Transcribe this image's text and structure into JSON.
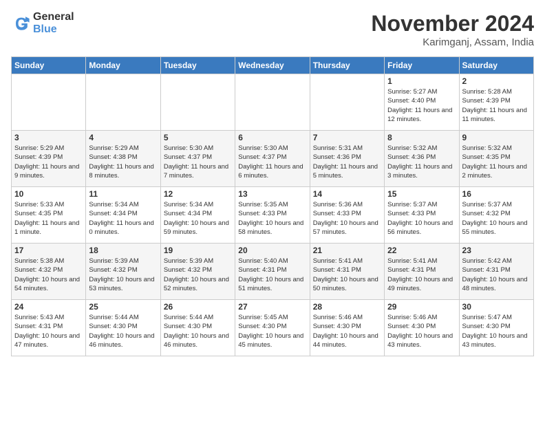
{
  "header": {
    "logo_general": "General",
    "logo_blue": "Blue",
    "month_title": "November 2024",
    "location": "Karimganj, Assam, India"
  },
  "calendar": {
    "days_of_week": [
      "Sunday",
      "Monday",
      "Tuesday",
      "Wednesday",
      "Thursday",
      "Friday",
      "Saturday"
    ],
    "weeks": [
      [
        {
          "day": "",
          "info": ""
        },
        {
          "day": "",
          "info": ""
        },
        {
          "day": "",
          "info": ""
        },
        {
          "day": "",
          "info": ""
        },
        {
          "day": "",
          "info": ""
        },
        {
          "day": "1",
          "info": "Sunrise: 5:27 AM\nSunset: 4:40 PM\nDaylight: 11 hours and 12 minutes."
        },
        {
          "day": "2",
          "info": "Sunrise: 5:28 AM\nSunset: 4:39 PM\nDaylight: 11 hours and 11 minutes."
        }
      ],
      [
        {
          "day": "3",
          "info": "Sunrise: 5:29 AM\nSunset: 4:39 PM\nDaylight: 11 hours and 9 minutes."
        },
        {
          "day": "4",
          "info": "Sunrise: 5:29 AM\nSunset: 4:38 PM\nDaylight: 11 hours and 8 minutes."
        },
        {
          "day": "5",
          "info": "Sunrise: 5:30 AM\nSunset: 4:37 PM\nDaylight: 11 hours and 7 minutes."
        },
        {
          "day": "6",
          "info": "Sunrise: 5:30 AM\nSunset: 4:37 PM\nDaylight: 11 hours and 6 minutes."
        },
        {
          "day": "7",
          "info": "Sunrise: 5:31 AM\nSunset: 4:36 PM\nDaylight: 11 hours and 5 minutes."
        },
        {
          "day": "8",
          "info": "Sunrise: 5:32 AM\nSunset: 4:36 PM\nDaylight: 11 hours and 3 minutes."
        },
        {
          "day": "9",
          "info": "Sunrise: 5:32 AM\nSunset: 4:35 PM\nDaylight: 11 hours and 2 minutes."
        }
      ],
      [
        {
          "day": "10",
          "info": "Sunrise: 5:33 AM\nSunset: 4:35 PM\nDaylight: 11 hours and 1 minute."
        },
        {
          "day": "11",
          "info": "Sunrise: 5:34 AM\nSunset: 4:34 PM\nDaylight: 11 hours and 0 minutes."
        },
        {
          "day": "12",
          "info": "Sunrise: 5:34 AM\nSunset: 4:34 PM\nDaylight: 10 hours and 59 minutes."
        },
        {
          "day": "13",
          "info": "Sunrise: 5:35 AM\nSunset: 4:33 PM\nDaylight: 10 hours and 58 minutes."
        },
        {
          "day": "14",
          "info": "Sunrise: 5:36 AM\nSunset: 4:33 PM\nDaylight: 10 hours and 57 minutes."
        },
        {
          "day": "15",
          "info": "Sunrise: 5:37 AM\nSunset: 4:33 PM\nDaylight: 10 hours and 56 minutes."
        },
        {
          "day": "16",
          "info": "Sunrise: 5:37 AM\nSunset: 4:32 PM\nDaylight: 10 hours and 55 minutes."
        }
      ],
      [
        {
          "day": "17",
          "info": "Sunrise: 5:38 AM\nSunset: 4:32 PM\nDaylight: 10 hours and 54 minutes."
        },
        {
          "day": "18",
          "info": "Sunrise: 5:39 AM\nSunset: 4:32 PM\nDaylight: 10 hours and 53 minutes."
        },
        {
          "day": "19",
          "info": "Sunrise: 5:39 AM\nSunset: 4:32 PM\nDaylight: 10 hours and 52 minutes."
        },
        {
          "day": "20",
          "info": "Sunrise: 5:40 AM\nSunset: 4:31 PM\nDaylight: 10 hours and 51 minutes."
        },
        {
          "day": "21",
          "info": "Sunrise: 5:41 AM\nSunset: 4:31 PM\nDaylight: 10 hours and 50 minutes."
        },
        {
          "day": "22",
          "info": "Sunrise: 5:41 AM\nSunset: 4:31 PM\nDaylight: 10 hours and 49 minutes."
        },
        {
          "day": "23",
          "info": "Sunrise: 5:42 AM\nSunset: 4:31 PM\nDaylight: 10 hours and 48 minutes."
        }
      ],
      [
        {
          "day": "24",
          "info": "Sunrise: 5:43 AM\nSunset: 4:31 PM\nDaylight: 10 hours and 47 minutes."
        },
        {
          "day": "25",
          "info": "Sunrise: 5:44 AM\nSunset: 4:30 PM\nDaylight: 10 hours and 46 minutes."
        },
        {
          "day": "26",
          "info": "Sunrise: 5:44 AM\nSunset: 4:30 PM\nDaylight: 10 hours and 46 minutes."
        },
        {
          "day": "27",
          "info": "Sunrise: 5:45 AM\nSunset: 4:30 PM\nDaylight: 10 hours and 45 minutes."
        },
        {
          "day": "28",
          "info": "Sunrise: 5:46 AM\nSunset: 4:30 PM\nDaylight: 10 hours and 44 minutes."
        },
        {
          "day": "29",
          "info": "Sunrise: 5:46 AM\nSunset: 4:30 PM\nDaylight: 10 hours and 43 minutes."
        },
        {
          "day": "30",
          "info": "Sunrise: 5:47 AM\nSunset: 4:30 PM\nDaylight: 10 hours and 43 minutes."
        }
      ]
    ]
  }
}
